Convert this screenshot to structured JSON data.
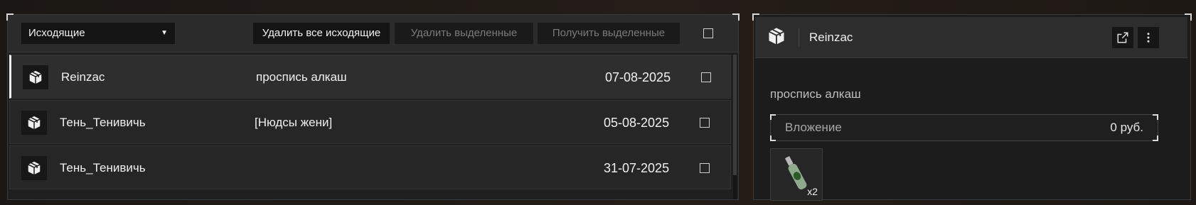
{
  "mailbox": {
    "filter_value": "Исходящие",
    "buttons": {
      "delete_all": "Удалить все исходящие",
      "delete_selected": "Удалить выделенные",
      "receive_selected": "Получить выделенные"
    },
    "rows": [
      {
        "icon": "package-icon",
        "sender": "Reinzac",
        "subject": "проспись алкаш",
        "date": "07-08-2025",
        "selected": true
      },
      {
        "icon": "package-icon",
        "sender": "Тень_Тенивичь",
        "subject": "[Нюдсы жени]",
        "date": "05-08-2025",
        "selected": false
      },
      {
        "icon": "package-icon",
        "sender": "Тень_Тенивичь",
        "subject": "",
        "date": "31-07-2025",
        "selected": false
      }
    ]
  },
  "detail": {
    "sender": "Reinzac",
    "message": "проспись алкаш",
    "attachment_label": "Вложение",
    "attachment_value": "0 руб.",
    "item_quantity": "x2",
    "icons": {
      "header": "package-icon",
      "open": "external-link-icon",
      "menu": "more-vertical-icon",
      "item": "bottle-icon"
    }
  },
  "colors": {
    "accent": "#efefef",
    "panel": "#1f1f1f",
    "row": "#262626"
  }
}
